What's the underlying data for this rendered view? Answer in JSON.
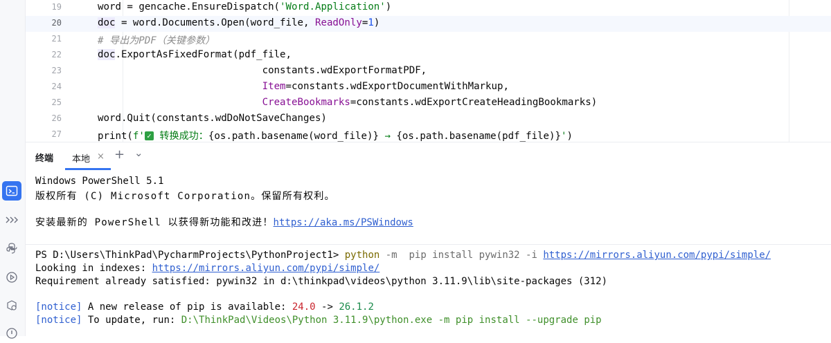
{
  "editor": {
    "lines": [
      {
        "n": "19",
        "segs": [
          {
            "t": "word = gencache.EnsureDispatch(",
            "c": ""
          },
          {
            "t": "'Word.Application'",
            "c": "str"
          },
          {
            "t": ")",
            "c": ""
          }
        ]
      },
      {
        "n": "20",
        "segs": [
          {
            "t": "doc",
            "c": "dochl"
          },
          {
            "t": " = word.Documents.Open(word_file, ",
            "c": ""
          },
          {
            "t": "ReadOnly",
            "c": "kw"
          },
          {
            "t": "=",
            "c": ""
          },
          {
            "t": "1",
            "c": "num"
          },
          {
            "t": ")",
            "c": ""
          }
        ]
      },
      {
        "n": "21",
        "segs": [
          {
            "t": "# 导出为PDF（关键参数）",
            "c": "cmt"
          }
        ]
      },
      {
        "n": "22",
        "segs": [
          {
            "t": "doc",
            "c": "dochl"
          },
          {
            "t": ".ExportAsFixedFormat(pdf_file,",
            "c": ""
          }
        ]
      },
      {
        "n": "23",
        "segs": [
          {
            "t": "                            constants.wdExportFormatPDF,",
            "c": ""
          }
        ]
      },
      {
        "n": "24",
        "segs": [
          {
            "t": "                            ",
            "c": ""
          },
          {
            "t": "Item",
            "c": "kw"
          },
          {
            "t": "=constants.wdExportDocumentWithMarkup,",
            "c": ""
          }
        ]
      },
      {
        "n": "25",
        "segs": [
          {
            "t": "                            ",
            "c": ""
          },
          {
            "t": "CreateBookmarks",
            "c": "kw"
          },
          {
            "t": "=constants.wdExportCreateHeadingBookmarks)",
            "c": ""
          }
        ]
      },
      {
        "n": "26",
        "segs": [
          {
            "t": "word.Quit(constants.wdDoNotSaveChanges)",
            "c": ""
          }
        ]
      },
      {
        "n": "27",
        "segs": [
          {
            "t": "print(",
            "c": ""
          },
          {
            "t": "f'",
            "c": "str"
          },
          {
            "t": "✓",
            "c": "checkmark"
          },
          {
            "t": " 转换成功：",
            "c": "str"
          },
          {
            "t": "{os.path.basename(word_file)}",
            "c": ""
          },
          {
            "t": " → ",
            "c": "str"
          },
          {
            "t": "{os.path.basename(pdf_file)}",
            "c": ""
          },
          {
            "t": "'",
            "c": "str"
          },
          {
            "t": ")",
            "c": ""
          }
        ]
      }
    ]
  },
  "panel": {
    "title": "终端",
    "tab_label": "本地",
    "close_glyph": "×",
    "add_glyph": "+",
    "dropdown_glyph": "⌄"
  },
  "terminal": {
    "line1": "Windows PowerShell 5.1",
    "line2": "版权所有 (C) Microsoft Corporation。保留所有权利。",
    "line3_prefix": "安装最新的 PowerShell 以获得新功能和改进！",
    "line3_link": "https://aka.ms/PSWindows",
    "prompt": "PS D:\\Users\\ThinkPad\\PycharmProjects\\PythonProject1> ",
    "cmd_python": "python",
    "cmd_flag": " -m",
    "cmd_rest": "  pip install pywin32 -i ",
    "cmd_link": "https://mirrors.aliyun.com/pypi/simple/",
    "looking_prefix": "Looking in indexes: ",
    "looking_link": "https://mirrors.aliyun.com/pypi/simple/",
    "requirement": "Requirement already satisfied: pywin32 in d:\\thinkpad\\videos\\python 3.11.9\\lib\\site-packages (312)",
    "notice_tag": "[notice]",
    "notice1_text": " A new release of pip is available: ",
    "old_version": "24.0",
    "arrow": " -> ",
    "new_version": "26.1.2",
    "notice2_text": " To update, run: ",
    "update_cmd": "D:\\ThinkPad\\Videos\\Python 3.11.9\\python.exe -m pip install --upgrade pip"
  },
  "strip_icons": [
    "terminal-icon",
    "chevrons-icon",
    "python-icon",
    "run-icon",
    "services-icon",
    "info-icon"
  ],
  "colors": {
    "accent": "#3574f0",
    "string": "#067d17",
    "keyword": "#871094",
    "number": "#1750eb",
    "comment": "#8c8c8c"
  }
}
